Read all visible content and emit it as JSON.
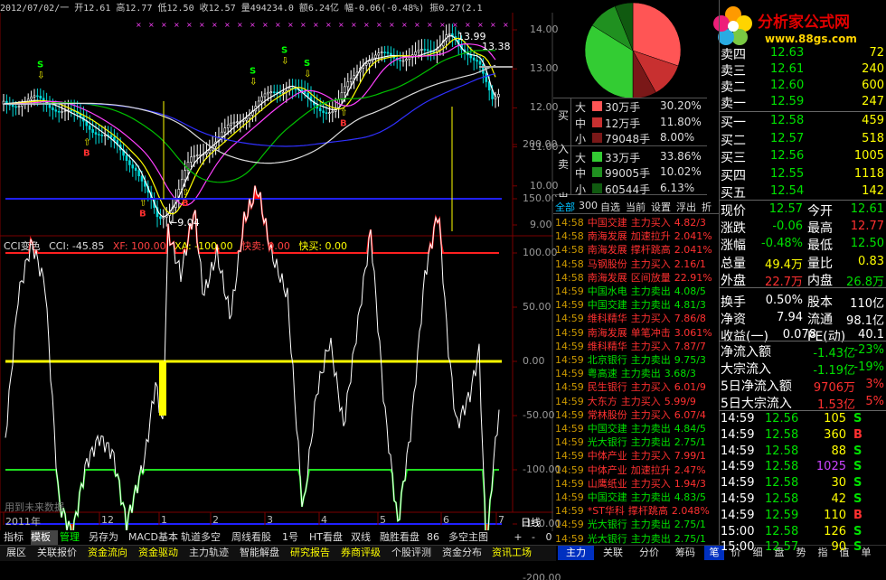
{
  "window": {
    "topbar_text": "2012/07/02/一 开12.61 高12.77 低12.50 收12.57 量494234.0 额6.24亿 幅-0.06(-0.48%) 振0.27(2.1"
  },
  "logo": {
    "brand": "分析家公式网",
    "url": "www.88gs.com"
  },
  "colors": {
    "up": "#ff3030",
    "down": "#00e000",
    "yellow": "#ffff00",
    "blue_line": "#2020ff",
    "bg": "#000000"
  },
  "price_chart": {
    "y_ticks": [
      "14.00",
      "13.00",
      "12.00",
      "11.00",
      "10.00",
      "9.00"
    ],
    "annotations": {
      "high_label": "13.99",
      "last_label": "13.38",
      "low_label": "←9.04"
    },
    "buy_marker": "B",
    "sell_marker": "S"
  },
  "cci_panel": {
    "label_name": "CCI变色",
    "label_cci": "CCI: -45.85",
    "label_xf": "XF: 100.00",
    "label_xa": "XA: -100.00",
    "label_ks": "快卖: 0.00",
    "label_km": "快买: 0.00",
    "y_ticks": [
      "200.00",
      "150.00",
      "100.00",
      "50.00",
      "0.00",
      "-50.00",
      "-100.00",
      "-150.00",
      "-200.00"
    ],
    "watermark": "用到未来数据"
  },
  "time_axis": {
    "labels": [
      "2011年",
      "12",
      "1",
      "2",
      "3",
      "4",
      "5",
      "6",
      "7"
    ],
    "right_label": "日线"
  },
  "bottom_tabs": [
    "指标",
    "模板",
    "管理",
    "另存为",
    "MACD基本",
    "轨道多空",
    "周线看股",
    "1号",
    "HT看盘",
    "双线",
    "融胜看盘",
    "86",
    "多空主图"
  ],
  "bottom_controls": [
    "+",
    "-",
    "0"
  ],
  "menu_bar": [
    "展区",
    "关联报价",
    "资金流向",
    "资金驱动",
    "主力轨迹",
    "智能解盘",
    "研究报告",
    "券商评级",
    "个股评测",
    "资金分布",
    "资讯工场"
  ],
  "right_tabs": [
    "主力",
    "关联",
    "分价",
    "筹码",
    "笔",
    "价",
    "细",
    "盘",
    "势",
    "指",
    "值",
    "单"
  ],
  "pie": {
    "slices": [
      {
        "label": "买大",
        "percent": 30.2,
        "color": "#ff5555"
      },
      {
        "label": "买中",
        "percent": 11.8,
        "color": "#c83030"
      },
      {
        "label": "买小",
        "percent": 8.0,
        "color": "#7a1818"
      },
      {
        "label": "卖大",
        "percent": 33.86,
        "color": "#33cc33"
      },
      {
        "label": "卖中",
        "percent": 10.02,
        "color": "#209020"
      },
      {
        "label": "卖小",
        "percent": 6.13,
        "color": "#105a10"
      }
    ]
  },
  "flow": {
    "buy_side": "买入",
    "sell_side": "卖出",
    "rows": [
      {
        "size": "大",
        "amount": "30万手",
        "pct": "30.20%",
        "color": "#ff5555"
      },
      {
        "size": "中",
        "amount": "12万手",
        "pct": "11.80%",
        "color": "#c83030"
      },
      {
        "size": "小",
        "amount": "79048手",
        "pct": "8.00%",
        "color": "#7a1818"
      },
      {
        "size": "大",
        "amount": "33万手",
        "pct": "33.86%",
        "color": "#33cc33"
      },
      {
        "size": "中",
        "amount": "99005手",
        "pct": "10.02%",
        "color": "#209020"
      },
      {
        "size": "小",
        "amount": "60544手",
        "pct": "6.13%",
        "color": "#105a10"
      }
    ]
  },
  "order_book": {
    "asks": [
      {
        "label": "卖四",
        "price": "12.63",
        "vol": "72"
      },
      {
        "label": "卖三",
        "price": "12.61",
        "vol": "240"
      },
      {
        "label": "卖二",
        "price": "12.60",
        "vol": "600"
      },
      {
        "label": "卖一",
        "price": "12.59",
        "vol": "247"
      }
    ],
    "bids": [
      {
        "label": "买一",
        "price": "12.58",
        "vol": "459"
      },
      {
        "label": "买二",
        "price": "12.57",
        "vol": "518"
      },
      {
        "label": "买三",
        "price": "12.56",
        "vol": "1005"
      },
      {
        "label": "买四",
        "price": "12.55",
        "vol": "1118"
      },
      {
        "label": "买五",
        "price": "12.54",
        "vol": "142"
      }
    ]
  },
  "quote": {
    "rows": [
      {
        "l1": "现价",
        "v1": "12.57",
        "c1": "#00e000",
        "l2": "今开",
        "v2": "12.61",
        "c2": "#00e000"
      },
      {
        "l1": "涨跌",
        "v1": "-0.06",
        "c1": "#00e000",
        "l2": "最高",
        "v2": "12.77",
        "c2": "#ff3030"
      },
      {
        "l1": "涨幅",
        "v1": "-0.48%",
        "c1": "#00e000",
        "l2": "最低",
        "v2": "12.50",
        "c2": "#00e000"
      },
      {
        "l1": "总量",
        "v1": "49.4万",
        "c1": "#ffff00",
        "l2": "量比",
        "v2": "0.83",
        "c2": "#ffff00"
      },
      {
        "l1": "外盘",
        "v1": "22.7万",
        "c1": "#ff3030",
        "l2": "内盘",
        "v2": "26.8万",
        "c2": "#00e000"
      },
      {
        "l1": "换手",
        "v1": "0.50%",
        "c1": "#ffffff",
        "l2": "股本",
        "v2": "110亿",
        "c2": "#ffffff"
      },
      {
        "l1": "净资",
        "v1": "7.94",
        "c1": "#ffffff",
        "l2": "流通",
        "v2": "98.1亿",
        "c2": "#ffffff"
      },
      {
        "l1": "收益(一)",
        "v1": "0.078",
        "c1": "#ffffff",
        "l2": "PE(动)",
        "v2": "40.1",
        "c2": "#ffffff"
      }
    ]
  },
  "capital": {
    "rows": [
      {
        "label": "净流入额",
        "v": "-1.43亿",
        "p": "-23%"
      },
      {
        "label": "大宗流入",
        "v": "-1.19亿",
        "p": "-19%"
      },
      {
        "label": "5日净流入额",
        "v": "9706万",
        "p": "3%"
      },
      {
        "label": "5日大宗流入",
        "v": "1.53亿",
        "p": "5%"
      }
    ]
  },
  "ticks": {
    "rows": [
      {
        "time": "14:59",
        "price": "12.56",
        "vol": "105",
        "side": "S",
        "vc": "#ffff00",
        "sc": "#00e000"
      },
      {
        "time": "14:59",
        "price": "12.58",
        "vol": "360",
        "side": "B",
        "vc": "#ffff00",
        "sc": "#ff3030"
      },
      {
        "time": "14:59",
        "price": "12.58",
        "vol": "88",
        "side": "S",
        "vc": "#ffff00",
        "sc": "#00e000"
      },
      {
        "time": "14:59",
        "price": "12.58",
        "vol": "1025",
        "side": "S",
        "vc": "#cc44ff",
        "sc": "#00e000"
      },
      {
        "time": "14:59",
        "price": "12.58",
        "vol": "30",
        "side": "S",
        "vc": "#ffff00",
        "sc": "#00e000"
      },
      {
        "time": "14:59",
        "price": "12.58",
        "vol": "42",
        "side": "S",
        "vc": "#ffff00",
        "sc": "#00e000"
      },
      {
        "time": "14:59",
        "price": "12.59",
        "vol": "110",
        "side": "B",
        "vc": "#ffff00",
        "sc": "#ff3030"
      },
      {
        "time": "15:00",
        "price": "12.58",
        "vol": "126",
        "side": "S",
        "vc": "#ffff00",
        "sc": "#00e000"
      },
      {
        "time": "15:00",
        "price": "12.57",
        "vol": "90",
        "side": "S",
        "vc": "#ffff00",
        "sc": "#00e000"
      }
    ]
  },
  "radar": {
    "tabs": [
      "全部",
      "300",
      "自选",
      "当前",
      "设置",
      "浮出",
      "折"
    ],
    "rows": [
      {
        "time": "14:58",
        "name": "中国交建",
        "type": "主力买入",
        "val": "4.82/3"
      },
      {
        "time": "14:58",
        "name": "南海发展",
        "type": "加速拉升",
        "val": "2.041%"
      },
      {
        "time": "14:58",
        "name": "南海发展",
        "type": "撑杆跳高",
        "val": "2.041%"
      },
      {
        "time": "14:58",
        "name": "马钢股份",
        "type": "主力买入",
        "val": "2.16/1"
      },
      {
        "time": "14:58",
        "name": "南海发展",
        "type": "区间放量",
        "val": "22.91%"
      },
      {
        "time": "14:59",
        "name": "中国水电",
        "type": "主力卖出",
        "val": "4.08/5"
      },
      {
        "time": "14:59",
        "name": "中国交建",
        "type": "主力卖出",
        "val": "4.81/3"
      },
      {
        "time": "14:59",
        "name": "维科精华",
        "type": "主力买入",
        "val": "7.86/8"
      },
      {
        "time": "14:59",
        "name": "南海发展",
        "type": "单笔冲击",
        "val": "3.061%"
      },
      {
        "time": "14:59",
        "name": "维科精华",
        "type": "主力买入",
        "val": "7.87/7"
      },
      {
        "time": "14:59",
        "name": "北京银行",
        "type": "主力卖出",
        "val": "9.75/3"
      },
      {
        "time": "14:59",
        "name": "粤高速",
        "type": "主力卖出",
        "val": "3.68/3"
      },
      {
        "time": "14:59",
        "name": "民生银行",
        "type": "主力买入",
        "val": "6.01/9"
      },
      {
        "time": "14:59",
        "name": "大东方",
        "type": "主力买入",
        "val": "5.99/9"
      },
      {
        "time": "14:59",
        "name": "常林股份",
        "type": "主力买入",
        "val": "6.07/4"
      },
      {
        "time": "14:59",
        "name": "中国交建",
        "type": "主力卖出",
        "val": "4.84/5"
      },
      {
        "time": "14:59",
        "name": "光大银行",
        "type": "主力卖出",
        "val": "2.75/1"
      },
      {
        "time": "14:59",
        "name": "中体产业",
        "type": "主力买入",
        "val": "7.99/1"
      },
      {
        "time": "14:59",
        "name": "中体产业",
        "type": "加速拉升",
        "val": "2.47%"
      },
      {
        "time": "14:59",
        "name": "山鹰纸业",
        "type": "主力买入",
        "val": "1.94/3"
      },
      {
        "time": "14:59",
        "name": "中国交建",
        "type": "主力卖出",
        "val": "4.83/5"
      },
      {
        "time": "14:59",
        "name": "*ST华科",
        "type": "撑杆跳高",
        "val": "2.048%"
      },
      {
        "time": "14:59",
        "name": "光大银行",
        "type": "主力卖出",
        "val": "2.75/1"
      },
      {
        "time": "14:59",
        "name": "光大银行",
        "type": "主力卖出",
        "val": "2.75/1"
      }
    ]
  }
}
